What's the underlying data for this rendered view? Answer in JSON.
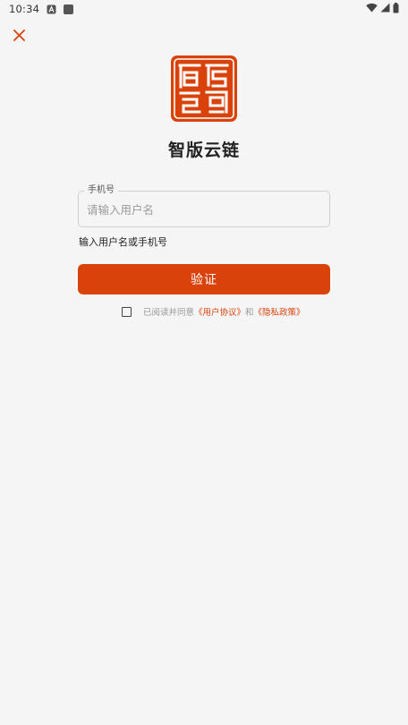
{
  "status_bar": {
    "time": "10:34",
    "left_icons": [
      "app-a-icon",
      "notification-square-icon"
    ],
    "right_icons": [
      "wifi-icon",
      "cell-signal-icon",
      "battery-icon"
    ]
  },
  "header": {
    "close_icon": "close-icon",
    "accent_color": "#d9420b"
  },
  "brand": {
    "logo_icon": "seal-logo-icon",
    "title": "智版云链"
  },
  "login_form": {
    "field_label": "手机号",
    "field_placeholder": "请输入用户名",
    "field_value": "",
    "helper_text": "输入用户名或手机号",
    "verify_label": "验证"
  },
  "agreement": {
    "checked": false,
    "prefix": "已阅读并同意",
    "user_agreement": "《用户协议》",
    "and": "和",
    "privacy_policy": "《隐私政策》"
  }
}
